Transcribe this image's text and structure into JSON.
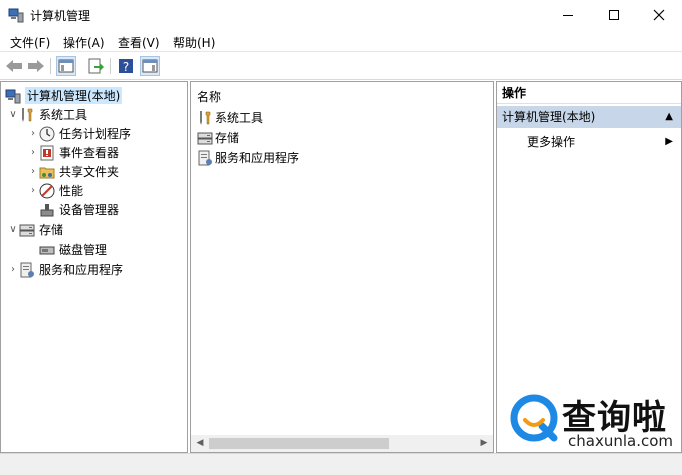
{
  "window": {
    "title": "计算机管理"
  },
  "menu": {
    "items": [
      "文件(F)",
      "操作(A)",
      "查看(V)",
      "帮助(H)"
    ]
  },
  "tree": {
    "root": "计算机管理(本地)",
    "system_tools": "系统工具",
    "task_scheduler": "任务计划程序",
    "event_viewer": "事件查看器",
    "shared_folders": "共享文件夹",
    "performance": "性能",
    "device_manager": "设备管理器",
    "storage": "存储",
    "disk_management": "磁盘管理",
    "services_apps": "服务和应用程序"
  },
  "list": {
    "header": "名称",
    "items": [
      "系统工具",
      "存储",
      "服务和应用程序"
    ]
  },
  "actions": {
    "title": "操作",
    "section": "计算机管理(本地)",
    "more": "更多操作"
  },
  "watermark": {
    "text": "查询啦",
    "url": "chaxunla.com"
  },
  "colors": {
    "selection": "#cce8ff",
    "action_section": "#c7d6e8",
    "watermark_blue": "#1e88e5",
    "watermark_orange": "#f39c12"
  }
}
